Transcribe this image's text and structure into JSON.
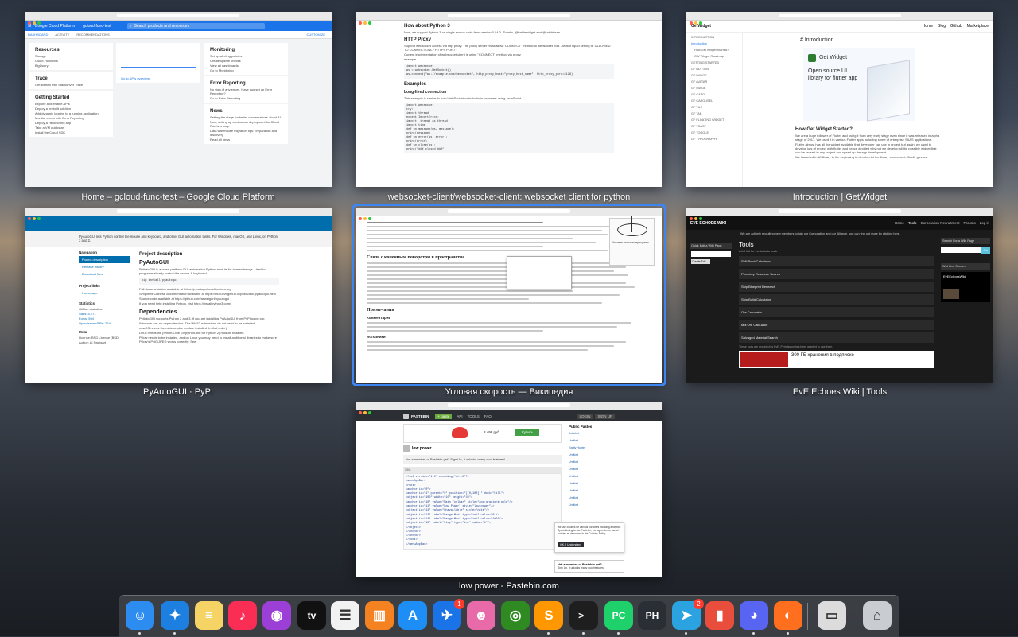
{
  "windows": {
    "gcp": {
      "caption": "Home – gcloud-func-test – Google Cloud Platform",
      "brand": "Google Cloud Platform",
      "project": "gcloud-func-test",
      "search_placeholder": "Search products and resources",
      "tabs": [
        "DASHBOARD",
        "ACTIVITY",
        "RECOMMENDATIONS"
      ],
      "customize": "CUSTOMIZE",
      "left_cards": [
        {
          "title": "Resources",
          "items": [
            "Storage",
            "Cloud Functions",
            "BigQuery"
          ]
        },
        {
          "title": "Trace",
          "items": [
            "Get started with Stackdriver Trace"
          ]
        },
        {
          "title": "Getting Started",
          "items": [
            "Explore and enable APIs",
            "Deploy a prebuilt solution",
            "Add dynamic logging to a running application",
            "Monitor errors with Error Reporting",
            "Deploy a Hello World app",
            "Take a VM quickstart",
            "Install the Cloud SDK"
          ]
        }
      ],
      "right_cards": [
        {
          "title": "Monitoring",
          "items": [
            "Set up alerting policies",
            "Create uptime checks",
            "View all dashboards",
            "Go to Monitoring"
          ]
        },
        {
          "title": "Error Reporting",
          "items": [
            "No sign of any errors. Have you set up Error Reporting?",
            "Go to Error Reporting"
          ]
        },
        {
          "title": "News",
          "items": [
            "Setting the stage for better conversations about AI",
            "Now, setting up continuous deployment for Cloud Run is a snap",
            "Data warehouse migration tips: preparation and discovery",
            "Read all news"
          ]
        }
      ],
      "apis_link": "Go to APIs overview"
    },
    "websocket": {
      "caption": "websocket-client/websocket-client: websocket client for python",
      "h1": "How about Python 3",
      "p1": "Now, we support Python 3 on single source code from version 0.14.0. Thanks, @battlemidget and @ralphbean.",
      "h2": "HTTP Proxy",
      "p2": "Support websocket access via http proxy. The proxy server must allow \"CONNECT\" method to websocket port. Default squid setting is \"ALLOWED TO CONNECT ONLY HTTPS PORT\".",
      "p3": "Current implementation of websocket-client is using \"CONNECT\" method via proxy.",
      "example": "example",
      "code1": [
        "import websocket",
        "ws = websocket.WebSocket()",
        "ws.connect(\"ws://example.com/websocket\", http_proxy_host=\"proxy_host_name\", http_proxy_port=3128)"
      ],
      "h3": "Examples",
      "h4": "Long-lived connection",
      "p4": "This example is similar to how WebSocket code looks in browsers using JavaScript.",
      "code2": [
        "import websocket",
        "try:",
        "    import thread",
        "except ImportError:",
        "    import _thread as thread",
        "import time",
        "",
        "def on_message(ws, message):",
        "    print(message)",
        "",
        "def on_error(ws, error):",
        "    print(error)",
        "",
        "def on_close(ws):",
        "    print(\"### closed ###\")"
      ]
    },
    "getwidget": {
      "caption": "Introduction | GetWidget",
      "brand": "GetWidget",
      "nav": [
        "Home",
        "Blog",
        "Github",
        "Marketplace"
      ],
      "sidebar": [
        "INTRODUCTION",
        "Introduction",
        "How Get Widget Started?",
        "GW Widget Roadmap",
        "GETTING STARTED",
        "GF BUTTON",
        "GF BADGE",
        "GF AVATAR",
        "GF IMAGE",
        "GF CARD",
        "GF CAROUSEL",
        "GF TILE",
        "GF TAB",
        "GF FLOATING WIDGET",
        "GF TOAST",
        "GF TOGGLE",
        "GF TYPOGRAPHY"
      ],
      "heading": "# Introduction",
      "banner_title": "Get Widget",
      "banner_sub": "Open source UI library for flutter app",
      "h2": "How Get Widget Started?",
      "p1": "We are a huge follower of Flutter and using it from very early stage even since it was released in alpha stage of 2017. We used it in various Flutter apps including some of enterprise SAAS applications.",
      "p2": "Flutter almost has all the widget available that developer can use in project but again, we used to develop lots of project with flutter and hence decided why not we develop all the possible widget that can be reused in any project and speed up the app development.",
      "p3": "We launched in UI library in the beginning to develop lot the library component. Kindly give us"
    },
    "pyautogui": {
      "caption": "PyAutoGUI · PyPI",
      "banner": "PyAutoGUI lets Python control the mouse and keyboard, and other GUI automation tasks. For Windows, macOS, and Linux, on Python 3 and 2.",
      "nav_title": "Navigation",
      "nav": [
        "Project description",
        "Release history",
        "Download files"
      ],
      "links_title": "Project links",
      "links": [
        "Homepage"
      ],
      "stats_title": "Statistics",
      "stats": [
        "GitHub statistics:",
        "Stars: 4,271",
        "Forks: 594",
        "Open issues/PRs: 264"
      ],
      "meta_title": "Meta",
      "meta": [
        "License: BSD License (BSD)",
        "Author: Al Sweigart"
      ],
      "h1": "Project description",
      "h2": "PyAutoGUI",
      "p1": "PyAutoGUI is a cross-platform GUI automation Python module for human beings. Used to programmatically control the mouse & keyboard.",
      "code": "pip install pyautogui",
      "p2": "Full documentation available at https://pyautogui.readthedocs.org",
      "p3": "Simplified Chinese documentation available at https://muxuezi.github.io/posts/doc-pyautogui.html",
      "p4": "Source code available at https://github.com/asweigart/pyautogui",
      "p5": "If you need help installing Python, visit https://installpython3.com/",
      "h3": "Dependencies",
      "p6": "PyAutoGUI supports Python 2 and 3. If you are installing PyAutoGUI from PyPI using pip:",
      "p7": "Windows has no dependencies. The Win32 extensions do not need to be installed.",
      "p8": "macOS needs the rubicon-objc module installed (in that order).",
      "p9": "Linux needs the python3-xlib (or python-xlib for Python 2) module installed.",
      "p10": "Pillow needs to be installed, and on Linux you may need to install additional libraries to make sure Pillow's PNG/JPEG works correctly. See:"
    },
    "wiki": {
      "caption": "Угловая скорость — Википедия",
      "figcaption": "Угловая скорость вращения",
      "h1": "Связь с конечным поворотом в пространстве",
      "h2": "Примечания",
      "h3": "Комментарии",
      "h4": "Источники"
    },
    "eve": {
      "caption": "EvE Echoes Wiki | Tools",
      "logo": "EVE ECHOES WIKI",
      "nav": [
        "Home",
        "Tools",
        "Corporation Recruitment",
        "Forums",
        "Log in"
      ],
      "notice": "We are actively recruiting new members to join our Corporation and our Alliance, you can find out more by clicking here.",
      "side_title": "Quick Edit a Wiki Page",
      "side_btn": "Create/Edit",
      "title": "Tools",
      "subtitle": "A full list for the tools to track",
      "items": [
        "Skill Point Calculator",
        "Planetary Resource Search",
        "Ship Blueprint Research",
        "Ship Build Calculator",
        "Ore Calculator",
        "Mol Ore Calculator",
        "Salvaged Material Search"
      ],
      "footer": "These tools are provided by EvE. Permission has been granted to use them.",
      "search_title": "Search For a Wiki Page",
      "search_btn": "Go",
      "stream_title": "Wiki Live Stream",
      "stream_name": "EvEEchoesWiki",
      "ad_text": "300 ГБ хранения в подписке"
    },
    "pastebin": {
      "caption": "low power - Pastebin.com",
      "brand": "PASTEBIN",
      "nav": [
        "API",
        "TOOLS",
        "FAQ"
      ],
      "paste_btn": "+ paste",
      "login": "LOGIN",
      "signup": "SIGN UP",
      "ad_price": "8 499 руб.",
      "ad_btn": "Купить",
      "paste_title": "low power",
      "notice": "Not a member of Pastebin yet? Sign Up, it unlocks many cool features!",
      "lang": "XML",
      "public_title": "Public Pastes",
      "public": [
        "dshahid",
        "Untitled",
        "Rarity Hunter",
        "Untitled",
        "Untitled",
        "Untitled",
        "Untitled",
        "Untitled",
        "Untitled",
        "Untitled",
        "Untitled"
      ],
      "code": [
        "<?xml version=\"1.0\" encoding=\"utf-8\"?>",
        "<menuAppBar>",
        "  <root>",
        "    <anchor id=\"0\">",
        "      <anchor id=\"1\" parent=\"0\" position=\"[[0,100]]\" dock=\"Fill\">",
        "        <object id=\"100\" width=\"10\" height=\"40\">",
        "          <anchor id=\"10\" value=\"Main Toolbar\" style=\"app;gradient;gold\"/>",
        "          <anchor id=\"11\" value=\"Low Power\" style=\"low;power\"/>",
        "          <object id=\"12\" value=\"Unavailable\" style=\"note\"/>",
        "          <object id=\"13\" label=\"Range Min\" type=\"int\" value=\"0\"/>",
        "          <object id=\"14\" label=\"Range Max\" type=\"int\" value=\"100\"/>",
        "          <object id=\"15\" label=\"Step\" type=\"int\" value=\"1\"/>",
        "        </object>",
        "      </anchor>",
        "    </anchor>",
        "  </root>",
        "</menuAppBar>"
      ],
      "member_title": "Not a member of Pastebin yet?",
      "member_text": "Sign Up, it unlocks many cool features!",
      "cookie": "We use cookies for various purposes including analytics. By continuing to use Pastebin, you agree to our use of cookies as described in the Cookies Policy.",
      "ok": "OK, I Understand"
    }
  },
  "dock": {
    "apps": [
      {
        "name": "finder",
        "glyph": "☺",
        "color": "#2d8cf0"
      },
      {
        "name": "safari",
        "glyph": "✦",
        "color": "#1d7fe0"
      },
      {
        "name": "notes",
        "glyph": "≡",
        "color": "#f6d365"
      },
      {
        "name": "music",
        "glyph": "♪",
        "color": "#fa2d55"
      },
      {
        "name": "podcasts",
        "glyph": "◉",
        "color": "#9b3fd6"
      },
      {
        "name": "tv",
        "glyph": "tv",
        "color": "#111111"
      },
      {
        "name": "reminders",
        "glyph": "☰",
        "color": "#f2f2f2"
      },
      {
        "name": "books",
        "glyph": "▥",
        "color": "#f58220"
      },
      {
        "name": "app-store",
        "glyph": "A",
        "color": "#1c8ef5"
      },
      {
        "name": "testflight",
        "glyph": "✈",
        "color": "#1a74e8",
        "badge": "1"
      },
      {
        "name": "gitmoji",
        "glyph": "☻",
        "color": "#e86aa8"
      },
      {
        "name": "nvidia",
        "glyph": "◎",
        "color": "#2f8a22"
      },
      {
        "name": "sublime",
        "glyph": "S",
        "color": "#ff9800"
      },
      {
        "name": "terminal",
        "glyph": ">_",
        "color": "#1e1e1e"
      },
      {
        "name": "pycharm",
        "glyph": "PC",
        "color": "#1fd16b"
      },
      {
        "name": "python",
        "glyph": "PH",
        "color": "#2a2f36"
      },
      {
        "name": "telegram",
        "glyph": "➤",
        "color": "#2aa3e0",
        "badge": "2"
      },
      {
        "name": "istat",
        "glyph": "▮",
        "color": "#e94e3c"
      },
      {
        "name": "discord",
        "glyph": "◕",
        "color": "#5865f2"
      },
      {
        "name": "firefox",
        "glyph": "◐",
        "color": "#ff6f1e"
      },
      {
        "name": "preview",
        "glyph": "▭",
        "color": "#dcdcdc"
      },
      {
        "name": "trash",
        "glyph": "⌂",
        "color": "#c9ccd0"
      }
    ]
  }
}
